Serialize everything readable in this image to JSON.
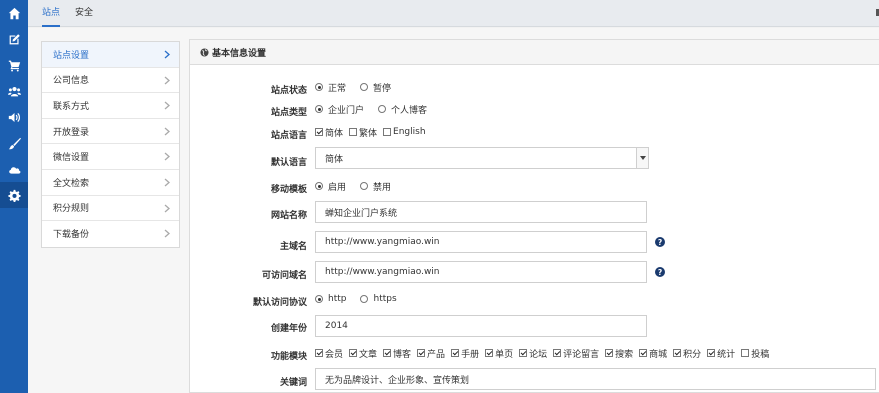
{
  "rail": {
    "items": [
      "home-icon",
      "edit-icon",
      "cart-icon",
      "users-icon",
      "volume-icon",
      "brush-icon",
      "cloud-icon",
      "gear-icon"
    ],
    "active_index": 7,
    "colors": {
      "bg": "#1c5fb0",
      "active": "#154d92"
    }
  },
  "topbar": {
    "tabs": [
      {
        "label": "站点",
        "active": true
      },
      {
        "label": "安全",
        "active": false
      }
    ]
  },
  "subnav": {
    "items": [
      {
        "label": "站点设置",
        "active": true
      },
      {
        "label": "公司信息",
        "active": false
      },
      {
        "label": "联系方式",
        "active": false
      },
      {
        "label": "开放登录",
        "active": false
      },
      {
        "label": "微信设置",
        "active": false
      },
      {
        "label": "全文检索",
        "active": false
      },
      {
        "label": "积分规则",
        "active": false
      },
      {
        "label": "下载备份",
        "active": false
      }
    ]
  },
  "panel": {
    "title": "基本信息设置",
    "icon": "globe-icon"
  },
  "form": {
    "site_status": {
      "label": "站点状态",
      "options": [
        "正常",
        "暂停"
      ],
      "selected": 0
    },
    "site_type": {
      "label": "站点类型",
      "options": [
        "企业门户",
        "个人博客"
      ],
      "selected": 0
    },
    "site_language": {
      "label": "站点语言",
      "options": [
        {
          "text": "简体",
          "checked": true
        },
        {
          "text": "繁体",
          "checked": false
        },
        {
          "text": "English",
          "checked": false
        }
      ]
    },
    "default_language": {
      "label": "默认语言",
      "value": "简体"
    },
    "mobile_template": {
      "label": "移动模板",
      "options": [
        "启用",
        "禁用"
      ],
      "selected": 0
    },
    "site_name": {
      "label": "网站名称",
      "value": "蝉知企业门户系统"
    },
    "main_domain": {
      "label": "主域名",
      "value": "http://www.yangmiao.win",
      "help_icon": "question-circle-icon"
    },
    "allowed_domains": {
      "label": "可访问域名",
      "value": "http://www.yangmiao.win",
      "help_icon": "question-circle-icon"
    },
    "default_protocol": {
      "label": "默认访问协议",
      "options": [
        "http",
        "https"
      ],
      "selected": 0
    },
    "founded_year": {
      "label": "创建年份",
      "value": "2014"
    },
    "modules": {
      "label": "功能模块",
      "options": [
        {
          "text": "会员",
          "checked": true
        },
        {
          "text": "文章",
          "checked": true
        },
        {
          "text": "博客",
          "checked": true
        },
        {
          "text": "产品",
          "checked": true
        },
        {
          "text": "手册",
          "checked": true
        },
        {
          "text": "单页",
          "checked": true
        },
        {
          "text": "论坛",
          "checked": true
        },
        {
          "text": "评论留言",
          "checked": true
        },
        {
          "text": "搜索",
          "checked": true
        },
        {
          "text": "商城",
          "checked": true
        },
        {
          "text": "积分",
          "checked": true
        },
        {
          "text": "统计",
          "checked": true
        },
        {
          "text": "投稿",
          "checked": false
        }
      ]
    },
    "keywords": {
      "label": "关键词",
      "value": "无为品牌设计、企业形象、宣传策划"
    }
  },
  "accent_color": "#2a6fc9"
}
